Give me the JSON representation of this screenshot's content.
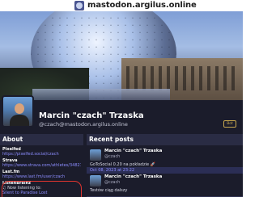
{
  "browser": {
    "site_name": "mastodon.argilus.online"
  },
  "profile": {
    "display_name": "Marcin \"czach\" Trzaska",
    "handle": "@czach@mastodon.argilus.online",
    "badge": "Bot"
  },
  "about": {
    "title": "About",
    "fields": [
      {
        "label": "Pixelfed",
        "value": "https://pixelfed.social/czach"
      },
      {
        "label": "Strava",
        "value": "https://www.strava.com/athletes/3482130"
      },
      {
        "label": "Last.fm",
        "value": "https://www.last.fm/user/czach"
      },
      {
        "label": "ListenBrainz",
        "value": "♫ Now listening to:",
        "value2": "Silent to Paradise Lost"
      }
    ]
  },
  "recent_posts": {
    "title": "Recent posts",
    "posts": [
      {
        "name": "Marcin \"czach\" Trzaska",
        "handle": "@czach",
        "text": "GoToSocial 0.20 na pokładzie 🚀",
        "date": "Oct 08, 2023 at 23:22"
      },
      {
        "name": "Marcin \"czach\" Trzaska",
        "handle": "@czach",
        "text": "Testów ciąg dalszy",
        "date": ""
      }
    ]
  }
}
